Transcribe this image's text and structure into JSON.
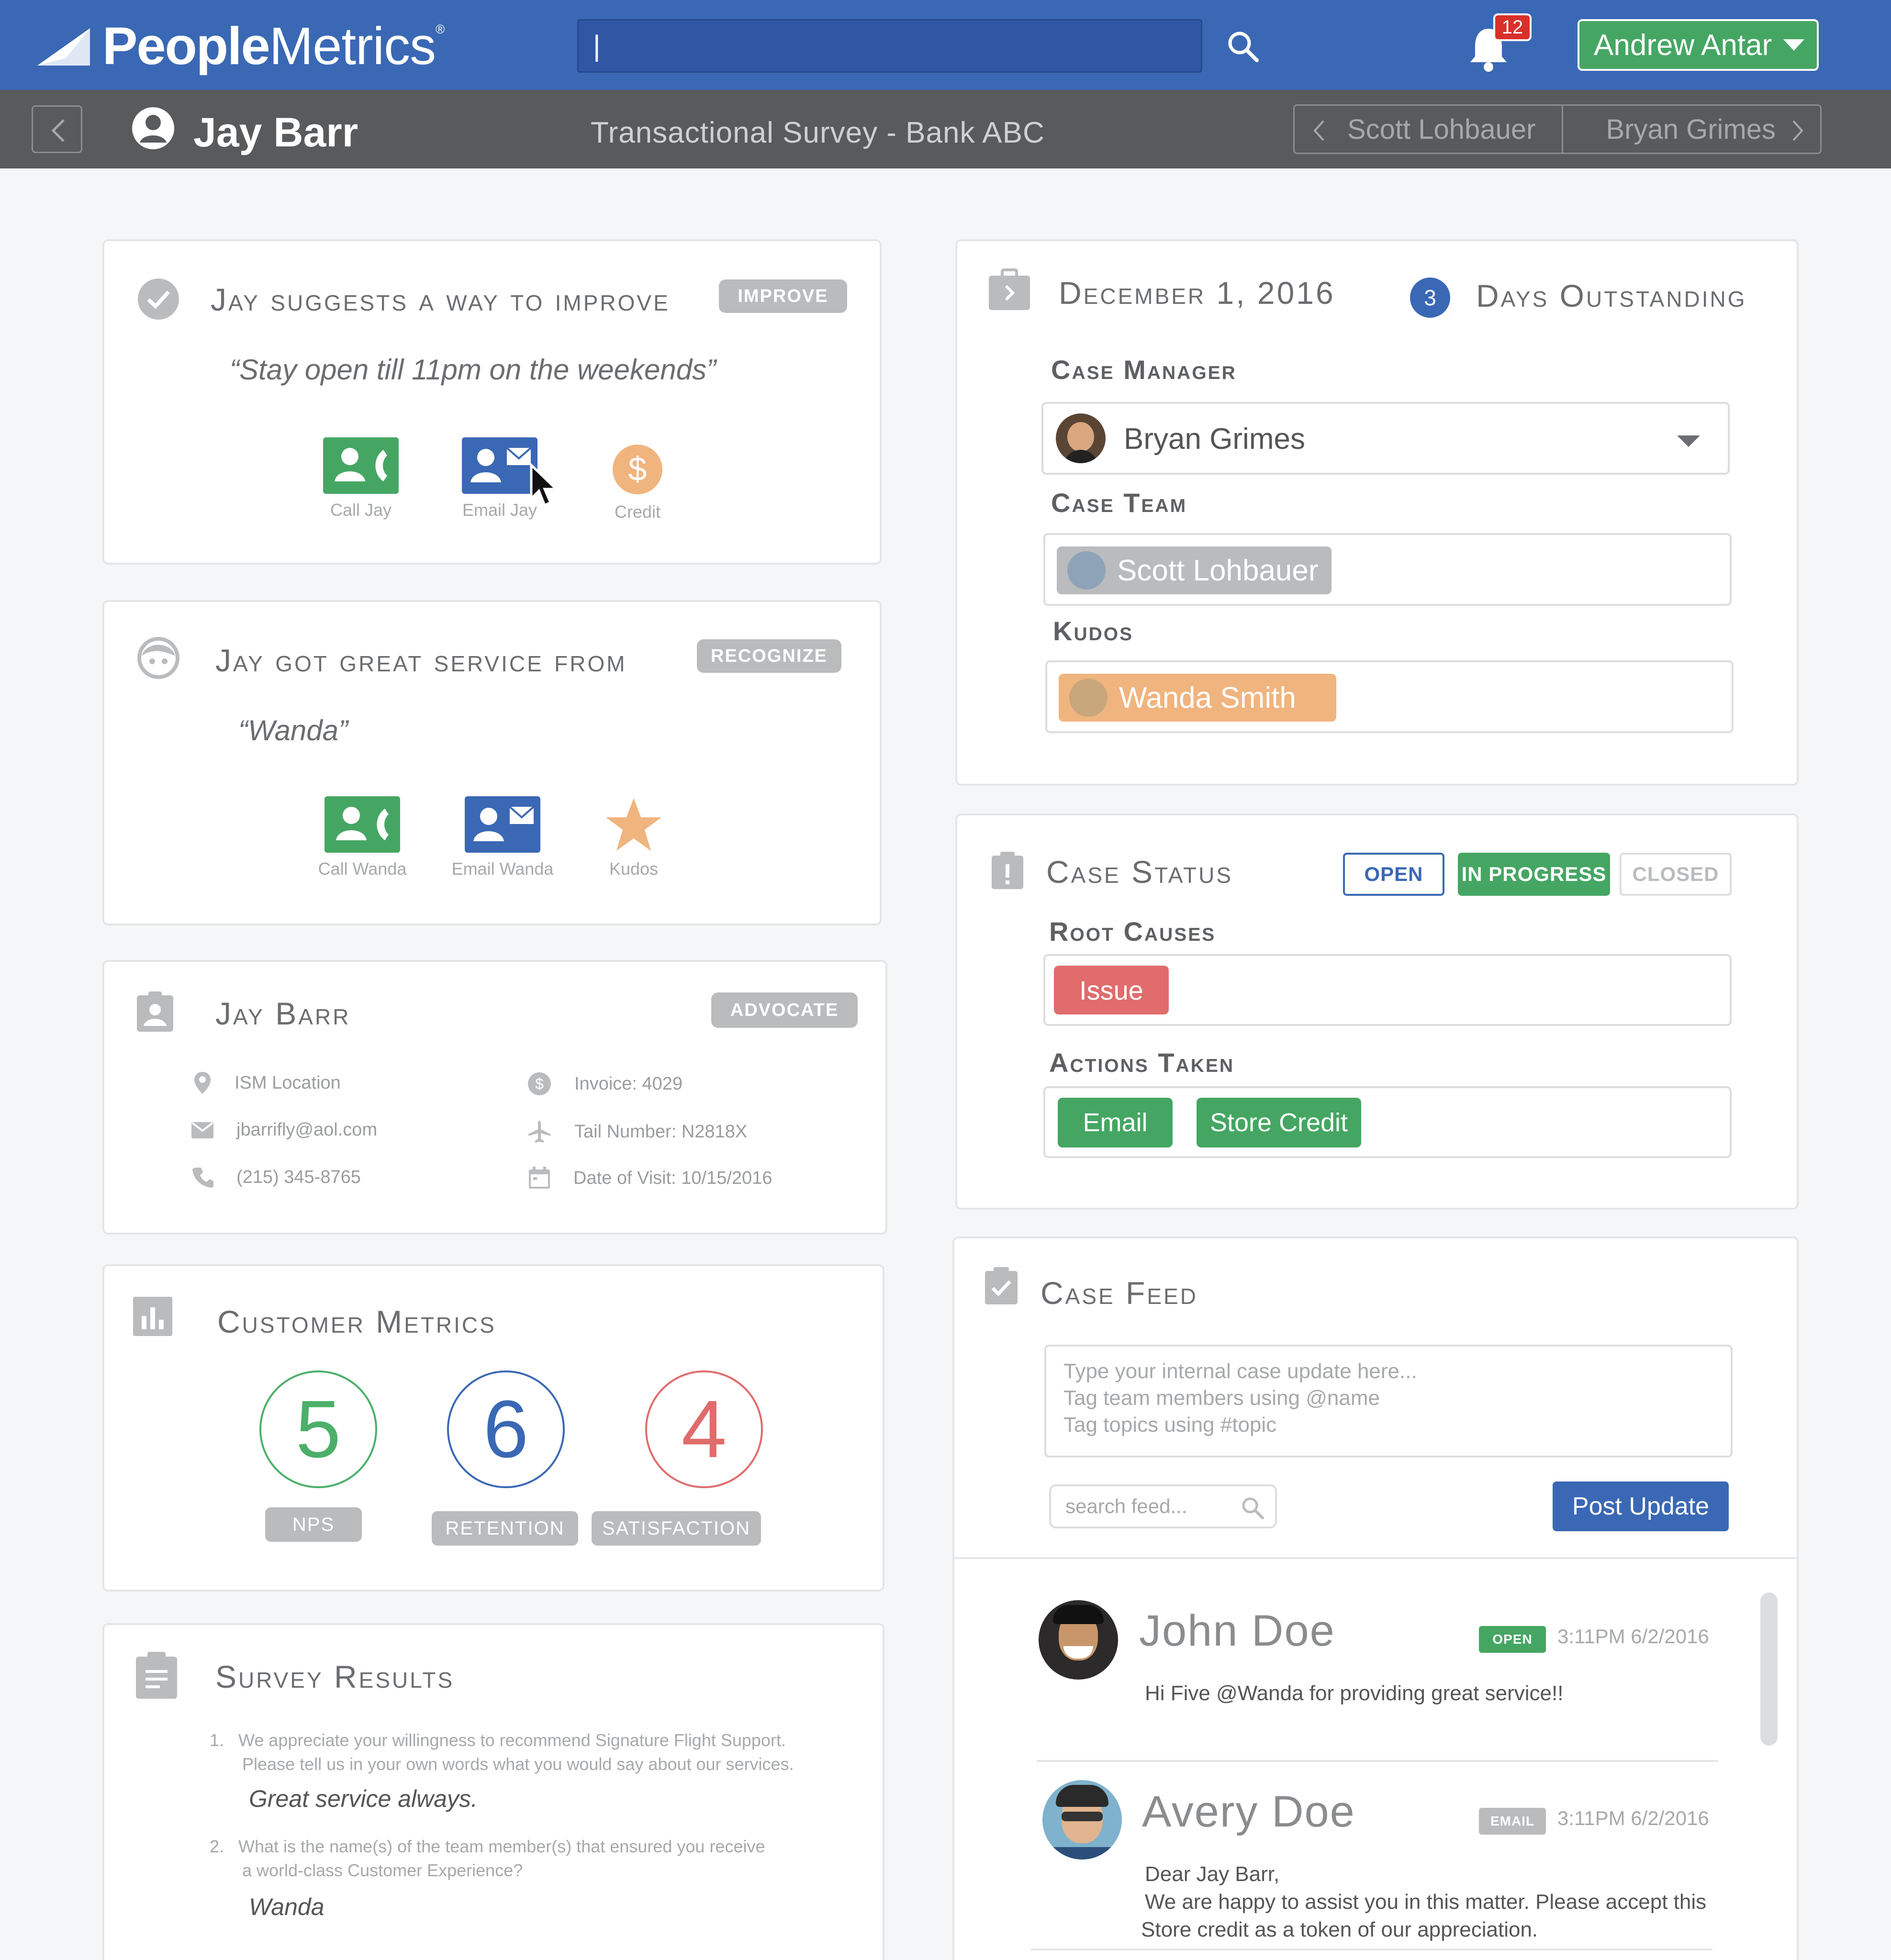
{
  "header": {
    "logo_bold": "People",
    "logo_light": "Metrics",
    "logo_reg": "®",
    "search_value": "|",
    "notification_count": "12",
    "user_name": "Andrew Antar"
  },
  "subheader": {
    "customer_name": "Jay Barr",
    "survey_title": "Transactional Survey - Bank ABC",
    "prev_person": "Scott Lohbauer",
    "next_person": "Bryan Grimes"
  },
  "improve_card": {
    "title": "Jay suggests a way to improve",
    "tag": "IMPROVE",
    "quote": "“Stay open till 11pm on the weekends”",
    "actions": [
      "Call Jay",
      "Email Jay",
      "Credit"
    ]
  },
  "service_card": {
    "title": "Jay got great service from",
    "tag": "RECOGNIZE",
    "quote": "“Wanda”",
    "actions": [
      "Call Wanda",
      "Email Wanda",
      "Kudos"
    ]
  },
  "profile_card": {
    "title": "Jay Barr",
    "tag": "ADVOCATE",
    "location": "ISM Location",
    "email": "jbarrifly@aol.com",
    "phone": "(215) 345-8765",
    "invoice": "Invoice: 4029",
    "tail": "Tail Number: N2818X",
    "visit": "Date of Visit: 10/15/2016"
  },
  "metrics_card": {
    "title": "Customer Metrics",
    "metrics": [
      {
        "value": "5",
        "label": "NPS",
        "color": "#4caf6a"
      },
      {
        "value": "6",
        "label": "RETENTION",
        "color": "#3a68b4"
      },
      {
        "value": "4",
        "label": "SATISFACTION",
        "color": "#e06c6c"
      }
    ]
  },
  "survey_card": {
    "title": "Survey Results",
    "questions": [
      {
        "num": "1.",
        "line1": "We appreciate your willingness to recommend Signature Flight Support.",
        "line2": "Please tell us in your own words what you would say about our services.",
        "answer": "Great service always."
      },
      {
        "num": "2.",
        "line1": "What is the name(s) of the team member(s) that ensured you receive",
        "line2": "a world-class Customer Experience?",
        "answer": "Wanda"
      }
    ]
  },
  "case_card": {
    "date": "December 1, 2016",
    "days_count": "3",
    "days_label": "Days Outstanding",
    "manager_label": "Case Manager",
    "manager": "Bryan Grimes",
    "team_label": "Case Team",
    "team_member": "Scott Lohbauer",
    "kudos_label": "Kudos",
    "kudos_person": "Wanda Smith"
  },
  "status_card": {
    "title": "Case Status",
    "open": "OPEN",
    "in_progress": "IN PROGRESS",
    "closed": "CLOSED",
    "root_label": "Root Causes",
    "root_cause": "Issue",
    "actions_label": "Actions Taken",
    "action_email": "Email",
    "action_credit": "Store Credit"
  },
  "feed_card": {
    "title": "Case Feed",
    "input_placeholder_1": "Type your internal case update here...",
    "input_placeholder_2": "Tag team members using @name",
    "input_placeholder_3": "Tag topics using #topic",
    "search_placeholder": "search feed...",
    "post_label": "Post Update",
    "entries": [
      {
        "name": "John Doe",
        "badge": "OPEN",
        "time": "3:11PM  6/2/2016",
        "message": "Hi Five @Wanda for providing great service!!"
      },
      {
        "name": "Avery Doe",
        "badge": "EMAIL",
        "time": "3:11PM  6/2/2016",
        "message_1": "Dear Jay Barr,",
        "message_2": "We are happy to assist you in this matter. Please accept this",
        "message_3": "Store credit as a token of our appreciation."
      }
    ]
  },
  "colors": {
    "brand_blue": "#3a68b4",
    "green": "#45a663",
    "orange": "#f0b47e",
    "red": "#e06c6c",
    "gray": "#585a5c"
  }
}
